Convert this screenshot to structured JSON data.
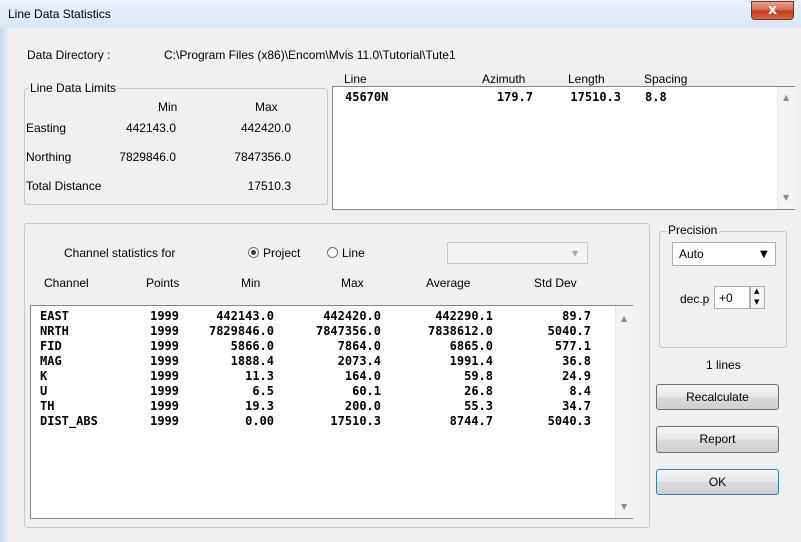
{
  "window": {
    "title": "Line Data Statistics",
    "close_glyph": "x"
  },
  "data_directory": {
    "label": "Data Directory :",
    "path": "C:\\Program Files (x86)\\Encom\\Mvis 11.0\\Tutorial\\Tute1"
  },
  "line_limits": {
    "legend": "Line Data Limits",
    "col_min": "Min",
    "col_max": "Max",
    "rows": [
      {
        "label": "Easting",
        "min": "442143.0",
        "max": "442420.0"
      },
      {
        "label": "Northing",
        "min": "7829846.0",
        "max": "7847356.0"
      }
    ],
    "total_label": "Total Distance",
    "total_value": "17510.3"
  },
  "lines_table": {
    "headers": {
      "line": "Line",
      "azimuth": "Azimuth",
      "length": "Length",
      "spacing": "Spacing"
    },
    "rows": [
      {
        "line": "45670N",
        "azimuth": "179.7",
        "length": "17510.3",
        "spacing": "8.8"
      }
    ]
  },
  "channel_stats": {
    "for_label": "Channel statistics for",
    "radio_project": "Project",
    "radio_line": "Line",
    "selected": "Project",
    "line_combo_value": "",
    "headers": {
      "channel": "Channel",
      "points": "Points",
      "min": "Min",
      "max": "Max",
      "average": "Average",
      "stddev": "Std Dev"
    },
    "rows": [
      {
        "channel": "EAST",
        "points": "1999",
        "min": "442143.0",
        "max": "442420.0",
        "average": "442290.1",
        "stddev": "89.7"
      },
      {
        "channel": "NRTH",
        "points": "1999",
        "min": "7829846.0",
        "max": "7847356.0",
        "average": "7838612.0",
        "stddev": "5040.7"
      },
      {
        "channel": "FID",
        "points": "1999",
        "min": "5866.0",
        "max": "7864.0",
        "average": "6865.0",
        "stddev": "577.1"
      },
      {
        "channel": "MAG",
        "points": "1999",
        "min": "1888.4",
        "max": "2073.4",
        "average": "1991.4",
        "stddev": "36.8"
      },
      {
        "channel": "K",
        "points": "1999",
        "min": "11.3",
        "max": "164.0",
        "average": "59.8",
        "stddev": "24.9"
      },
      {
        "channel": "U",
        "points": "1999",
        "min": "6.5",
        "max": "60.1",
        "average": "26.8",
        "stddev": "8.4"
      },
      {
        "channel": "TH",
        "points": "1999",
        "min": "19.3",
        "max": "200.0",
        "average": "55.3",
        "stddev": "34.7"
      },
      {
        "channel": "DIST_ABS",
        "points": "1999",
        "min": "0.00",
        "max": "17510.3",
        "average": "8744.7",
        "stddev": "5040.3"
      }
    ]
  },
  "precision": {
    "legend": "Precision",
    "mode_value": "Auto",
    "decp_label": "dec.p",
    "decp_value": "+0"
  },
  "line_count": "1 lines",
  "buttons": {
    "recalculate": "Recalculate",
    "report": "Report",
    "ok": "OK"
  },
  "icons": {
    "scroll_up": "▲",
    "scroll_down": "▼",
    "combo_arrow": "▼",
    "spin_up": "▲",
    "spin_down": "▼"
  },
  "colors": {
    "title_bar": "#dbe7f4",
    "close_button": "#c8432a",
    "dialog_bg": "#f0f0f0"
  }
}
